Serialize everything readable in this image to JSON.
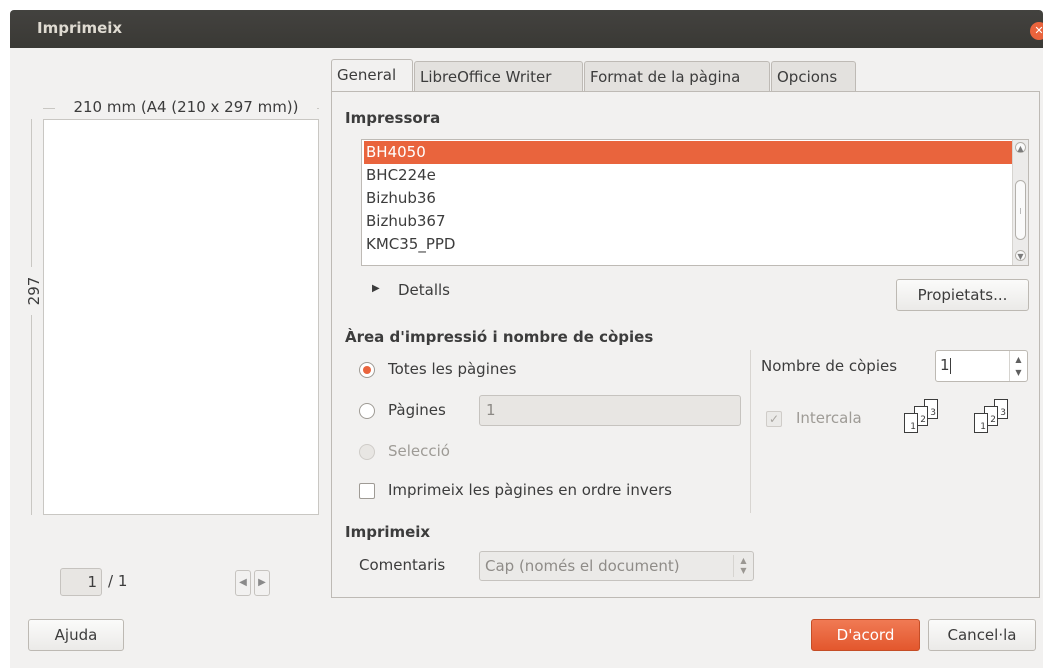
{
  "window": {
    "title": "Imprimeix"
  },
  "preview": {
    "paper_size_label": "210 mm (A4 (210 x 297 mm))",
    "height_label": "297 mm",
    "current_page": "1",
    "total_pages": "/ 1"
  },
  "tabs": [
    {
      "label": "General"
    },
    {
      "label": "LibreOffice Writer"
    },
    {
      "label": "Format de la pàgina"
    },
    {
      "label": "Opcions"
    }
  ],
  "printer": {
    "section_title": "Impressora",
    "items": [
      "BH4050",
      "BHC224e",
      "Bizhub36",
      "Bizhub367",
      "KMC35_PPD"
    ],
    "selected": "BH4050",
    "details_label": "Detalls",
    "properties_button": "Propietats..."
  },
  "range": {
    "section_title": "Àrea d'impressió i nombre de còpies",
    "all_pages_label": "Totes les pàgines",
    "pages_label": "Pàgines",
    "pages_value": "1",
    "selection_label": "Selecció",
    "reverse_label": "Imprimeix les pàgines en ordre invers",
    "copies_label": "Nombre de còpies",
    "copies_value": "1",
    "collate_label": "Intercala",
    "collate_pages": [
      "1",
      "2",
      "3"
    ]
  },
  "print_section": {
    "title": "Imprimeix",
    "comments_label": "Comentaris",
    "comments_value": "Cap (només el document)"
  },
  "buttons": {
    "help": "Ajuda",
    "ok": "D'acord",
    "cancel": "Cancel·la"
  },
  "colors": {
    "accent": "#e9643d",
    "titlebar": "#3c3b37",
    "window_bg": "#f2f1f0"
  }
}
